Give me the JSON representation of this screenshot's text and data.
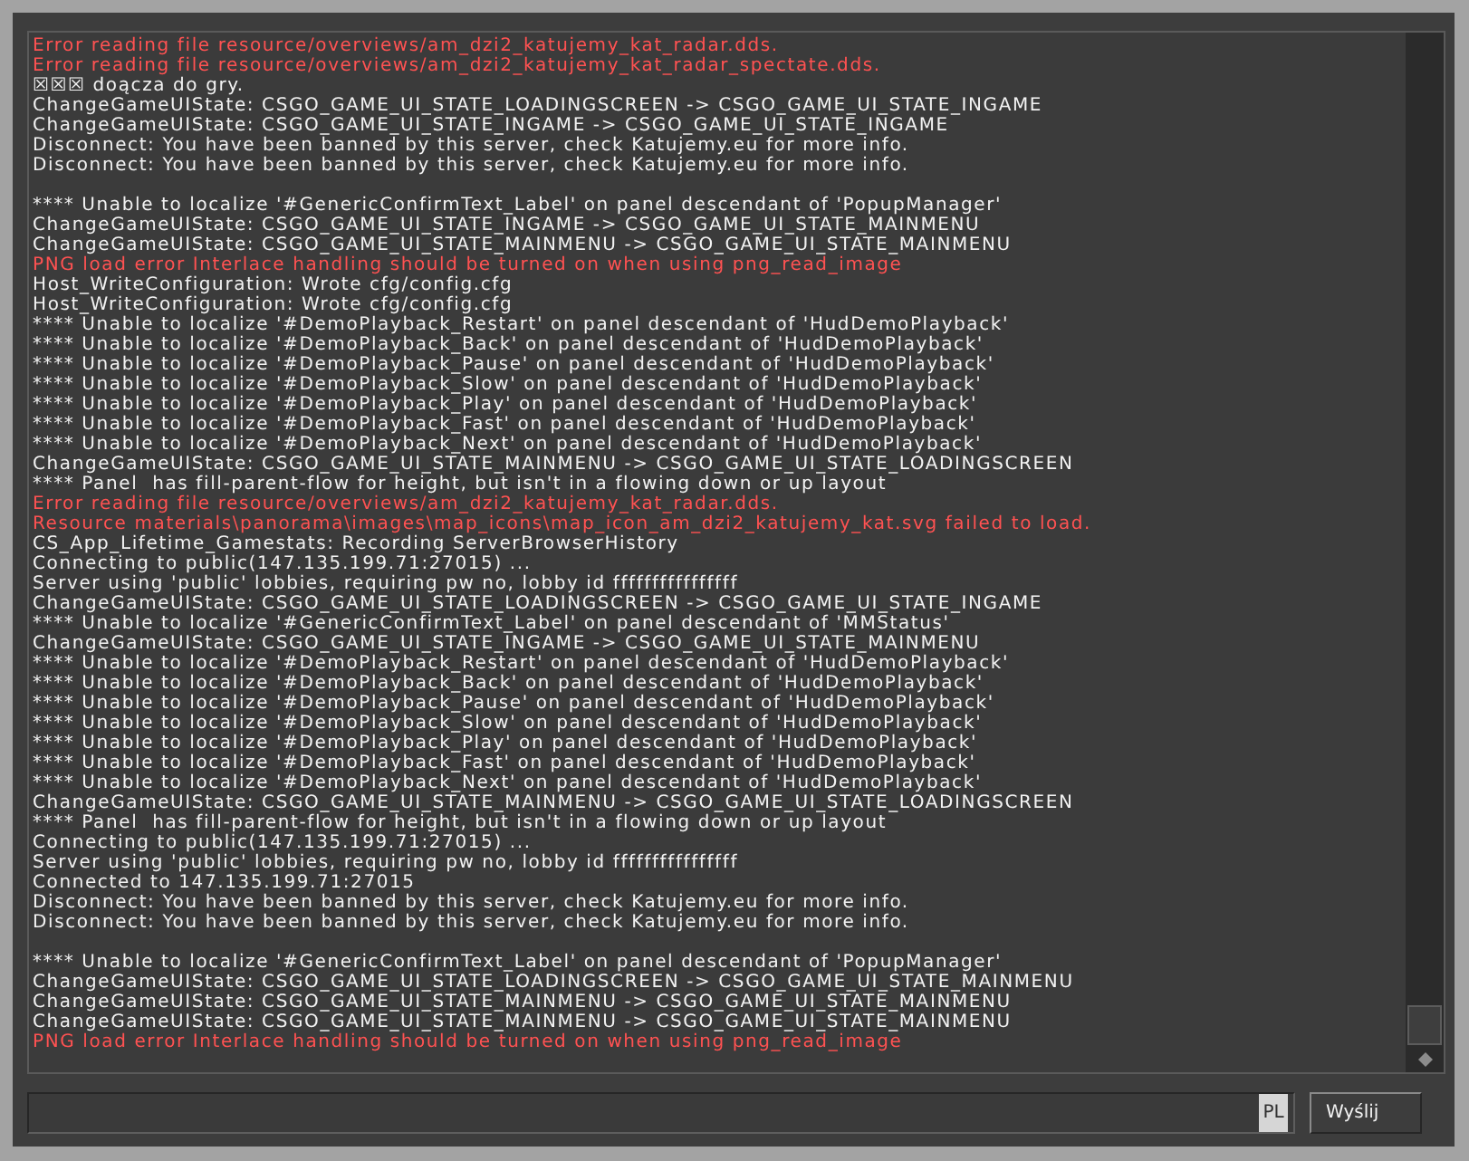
{
  "console": {
    "lines": [
      {
        "kind": "error",
        "text": "Error reading file resource/overviews/am_dzi2_katujemy_kat_radar.dds."
      },
      {
        "kind": "error",
        "text": "Error reading file resource/overviews/am_dzi2_katujemy_kat_radar_spectate.dds."
      },
      {
        "kind": "info",
        "text": "☒☒☒ doącza do gry."
      },
      {
        "kind": "info",
        "text": "ChangeGameUIState: CSGO_GAME_UI_STATE_LOADINGSCREEN -> CSGO_GAME_UI_STATE_INGAME"
      },
      {
        "kind": "info",
        "text": "ChangeGameUIState: CSGO_GAME_UI_STATE_INGAME -> CSGO_GAME_UI_STATE_INGAME"
      },
      {
        "kind": "info",
        "text": "Disconnect: You have been banned by this server, check Katujemy.eu for more info."
      },
      {
        "kind": "info",
        "text": "Disconnect: You have been banned by this server, check Katujemy.eu for more info."
      },
      {
        "kind": "spacer"
      },
      {
        "kind": "info",
        "text": "**** Unable to localize '#GenericConfirmText_Label' on panel descendant of 'PopupManager'"
      },
      {
        "kind": "info",
        "text": "ChangeGameUIState: CSGO_GAME_UI_STATE_INGAME -> CSGO_GAME_UI_STATE_MAINMENU"
      },
      {
        "kind": "info",
        "text": "ChangeGameUIState: CSGO_GAME_UI_STATE_MAINMENU -> CSGO_GAME_UI_STATE_MAINMENU"
      },
      {
        "kind": "error",
        "text": "PNG load error Interlace handling should be turned on when using png_read_image"
      },
      {
        "kind": "info",
        "text": "Host_WriteConfiguration: Wrote cfg/config.cfg"
      },
      {
        "kind": "info",
        "text": "Host_WriteConfiguration: Wrote cfg/config.cfg"
      },
      {
        "kind": "info",
        "text": "**** Unable to localize '#DemoPlayback_Restart' on panel descendant of 'HudDemoPlayback'"
      },
      {
        "kind": "info",
        "text": "**** Unable to localize '#DemoPlayback_Back' on panel descendant of 'HudDemoPlayback'"
      },
      {
        "kind": "info",
        "text": "**** Unable to localize '#DemoPlayback_Pause' on panel descendant of 'HudDemoPlayback'"
      },
      {
        "kind": "info",
        "text": "**** Unable to localize '#DemoPlayback_Slow' on panel descendant of 'HudDemoPlayback'"
      },
      {
        "kind": "info",
        "text": "**** Unable to localize '#DemoPlayback_Play' on panel descendant of 'HudDemoPlayback'"
      },
      {
        "kind": "info",
        "text": "**** Unable to localize '#DemoPlayback_Fast' on panel descendant of 'HudDemoPlayback'"
      },
      {
        "kind": "info",
        "text": "**** Unable to localize '#DemoPlayback_Next' on panel descendant of 'HudDemoPlayback'"
      },
      {
        "kind": "info",
        "text": "ChangeGameUIState: CSGO_GAME_UI_STATE_MAINMENU -> CSGO_GAME_UI_STATE_LOADINGSCREEN"
      },
      {
        "kind": "info",
        "text": "**** Panel  has fill-parent-flow for height, but isn't in a flowing down or up layout"
      },
      {
        "kind": "error",
        "text": "Error reading file resource/overviews/am_dzi2_katujemy_kat_radar.dds."
      },
      {
        "kind": "error",
        "text": "Resource materials\\panorama\\images\\map_icons\\map_icon_am_dzi2_katujemy_kat.svg failed to load."
      },
      {
        "kind": "info",
        "text": "CS_App_Lifetime_Gamestats: Recording ServerBrowserHistory"
      },
      {
        "kind": "info",
        "text": "Connecting to public(147.135.199.71:27015) ..."
      },
      {
        "kind": "info",
        "text": "Server using 'public' lobbies, requiring pw no, lobby id ffffffffffffffff"
      },
      {
        "kind": "info",
        "text": "ChangeGameUIState: CSGO_GAME_UI_STATE_LOADINGSCREEN -> CSGO_GAME_UI_STATE_INGAME"
      },
      {
        "kind": "info",
        "text": "**** Unable to localize '#GenericConfirmText_Label' on panel descendant of 'MMStatus'"
      },
      {
        "kind": "info",
        "text": "ChangeGameUIState: CSGO_GAME_UI_STATE_INGAME -> CSGO_GAME_UI_STATE_MAINMENU"
      },
      {
        "kind": "info",
        "text": "**** Unable to localize '#DemoPlayback_Restart' on panel descendant of 'HudDemoPlayback'"
      },
      {
        "kind": "info",
        "text": "**** Unable to localize '#DemoPlayback_Back' on panel descendant of 'HudDemoPlayback'"
      },
      {
        "kind": "info",
        "text": "**** Unable to localize '#DemoPlayback_Pause' on panel descendant of 'HudDemoPlayback'"
      },
      {
        "kind": "info",
        "text": "**** Unable to localize '#DemoPlayback_Slow' on panel descendant of 'HudDemoPlayback'"
      },
      {
        "kind": "info",
        "text": "**** Unable to localize '#DemoPlayback_Play' on panel descendant of 'HudDemoPlayback'"
      },
      {
        "kind": "info",
        "text": "**** Unable to localize '#DemoPlayback_Fast' on panel descendant of 'HudDemoPlayback'"
      },
      {
        "kind": "info",
        "text": "**** Unable to localize '#DemoPlayback_Next' on panel descendant of 'HudDemoPlayback'"
      },
      {
        "kind": "info",
        "text": "ChangeGameUIState: CSGO_GAME_UI_STATE_MAINMENU -> CSGO_GAME_UI_STATE_LOADINGSCREEN"
      },
      {
        "kind": "info",
        "text": "**** Panel  has fill-parent-flow for height, but isn't in a flowing down or up layout"
      },
      {
        "kind": "info",
        "text": "Connecting to public(147.135.199.71:27015) ..."
      },
      {
        "kind": "info",
        "text": "Server using 'public' lobbies, requiring pw no, lobby id ffffffffffffffff"
      },
      {
        "kind": "info",
        "text": "Connected to 147.135.199.71:27015"
      },
      {
        "kind": "info",
        "text": "Disconnect: You have been banned by this server, check Katujemy.eu for more info."
      },
      {
        "kind": "info",
        "text": "Disconnect: You have been banned by this server, check Katujemy.eu for more info."
      },
      {
        "kind": "spacer"
      },
      {
        "kind": "info",
        "text": "**** Unable to localize '#GenericConfirmText_Label' on panel descendant of 'PopupManager'"
      },
      {
        "kind": "info",
        "text": "ChangeGameUIState: CSGO_GAME_UI_STATE_LOADINGSCREEN -> CSGO_GAME_UI_STATE_MAINMENU"
      },
      {
        "kind": "info",
        "text": "ChangeGameUIState: CSGO_GAME_UI_STATE_MAINMENU -> CSGO_GAME_UI_STATE_MAINMENU"
      },
      {
        "kind": "info",
        "text": "ChangeGameUIState: CSGO_GAME_UI_STATE_MAINMENU -> CSGO_GAME_UI_STATE_MAINMENU"
      },
      {
        "kind": "error",
        "text": "PNG load error Interlace handling should be turned on when using png_read_image"
      }
    ]
  },
  "command_input": {
    "language": "PL"
  },
  "send_button": {
    "label": "Wyślij"
  }
}
